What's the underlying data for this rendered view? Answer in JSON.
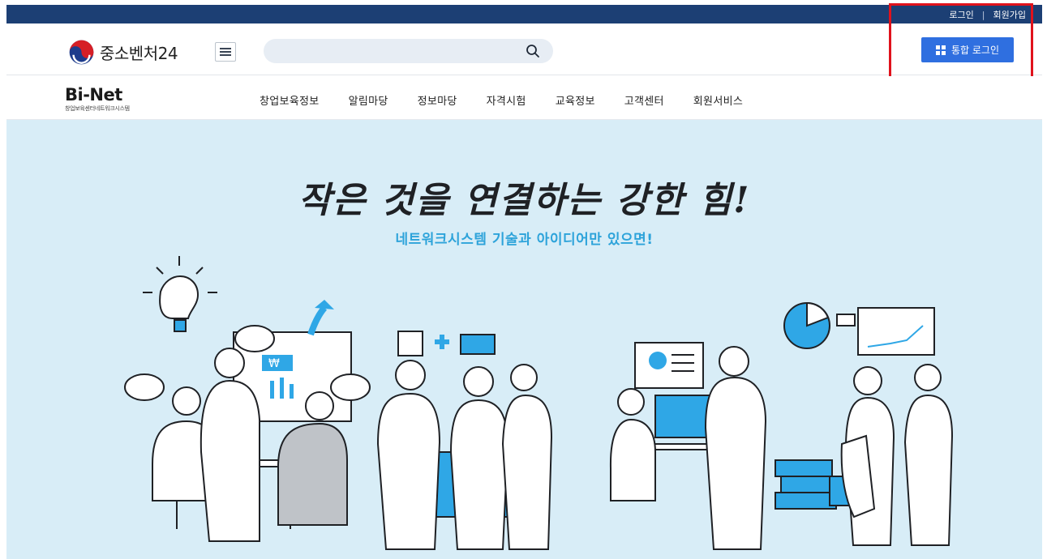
{
  "topbar": {
    "login": "로그인",
    "separator": "|",
    "signup": "회원가입"
  },
  "header": {
    "brand": "중소벤처24",
    "search": {
      "placeholder": "",
      "value": ""
    },
    "unified_login": "통합 로그인"
  },
  "site": {
    "logo_main": "Bi-Net",
    "logo_sub": "창업보육센터네트워크시스템"
  },
  "nav": [
    "창업보육정보",
    "알림마당",
    "정보마당",
    "자격시험",
    "교육정보",
    "고객센터",
    "회원서비스"
  ],
  "hero": {
    "title": "작은 것을 연결하는 강한 힘!",
    "subtitle": "네트워크시스템 기술과 아이디어만 있으면!",
    "currency_symbol": "₩"
  },
  "colors": {
    "topbar": "#1c3f74",
    "login_button": "#2f6fe0",
    "hero_bg": "#d8edf7",
    "subtitle": "#2da3da",
    "accent": "#2fa7e6",
    "highlight_box": "#e0121c"
  },
  "icons": [
    "taegeuk-logo-icon",
    "hamburger-menu-icon",
    "search-icon",
    "grid-icon",
    "lightbulb-icon",
    "arrow-up-icon",
    "pie-chart-icon",
    "line-chart-icon"
  ]
}
